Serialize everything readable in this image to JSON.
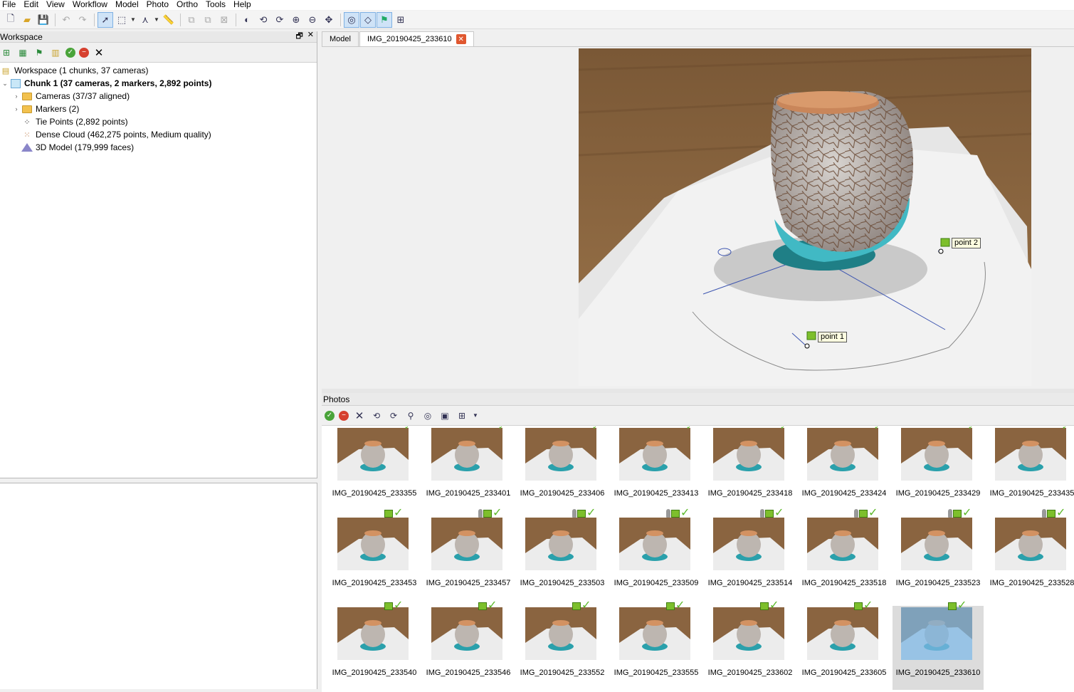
{
  "menu": [
    "File",
    "Edit",
    "View",
    "Workflow",
    "Model",
    "Photo",
    "Ortho",
    "Tools",
    "Help"
  ],
  "workspace": {
    "title": "Workspace",
    "tree": [
      {
        "label": "Workspace (1 chunks, 37 cameras)",
        "bold": false
      },
      {
        "label": "Chunk 1 (37 cameras, 2 markers, 2,892 points)",
        "bold": true
      },
      {
        "label": "Cameras (37/37 aligned)"
      },
      {
        "label": "Markers (2)"
      },
      {
        "label": "Tie Points (2,892 points)"
      },
      {
        "label": "Dense Cloud (462,275 points, Medium quality)"
      },
      {
        "label": "3D Model (179,999 faces)"
      }
    ]
  },
  "tabs": {
    "model": "Model",
    "image": "IMG_20190425_233610"
  },
  "markers": {
    "point1": "point 1",
    "point2": "point 2"
  },
  "photos": {
    "title": "Photos",
    "items": [
      "IMG_20190425_233355",
      "IMG_20190425_233401",
      "IMG_20190425_233406",
      "IMG_20190425_233413",
      "IMG_20190425_233418",
      "IMG_20190425_233424",
      "IMG_20190425_233429",
      "IMG_20190425_233435",
      "IMG_20190425_233453",
      "IMG_20190425_233457",
      "IMG_20190425_233503",
      "IMG_20190425_233509",
      "IMG_20190425_233514",
      "IMG_20190425_233518",
      "IMG_20190425_233523",
      "IMG_20190425_233528",
      "IMG_20190425_233540",
      "IMG_20190425_233546",
      "IMG_20190425_233552",
      "IMG_20190425_233555",
      "IMG_20190425_233602",
      "IMG_20190425_233605",
      "IMG_20190425_233610"
    ],
    "selected": "IMG_20190425_233610"
  }
}
